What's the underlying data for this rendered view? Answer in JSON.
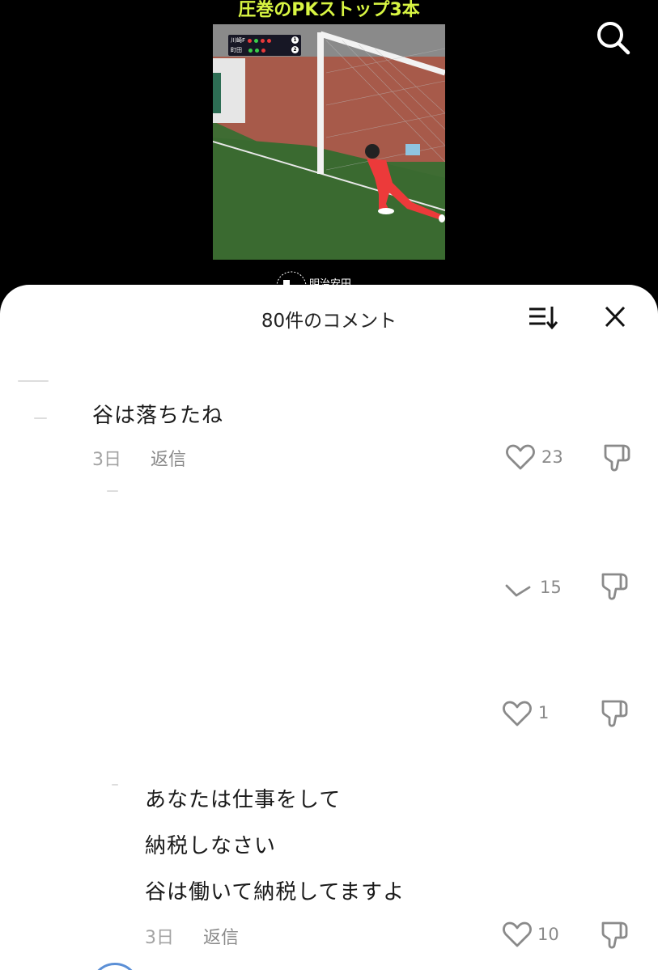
{
  "video": {
    "title": "圧巻のPKストップ3本",
    "scoreboard": {
      "team1": "川崎F",
      "team2": "町田",
      "score1": "1",
      "score2": "2"
    },
    "sponsor": "明治安田"
  },
  "comments_sheet": {
    "title": "80件のコメント",
    "comments": [
      {
        "lines": [
          "谷は落ちたね"
        ],
        "time": "3日",
        "reply_label": "返信",
        "likes": "23"
      },
      {
        "lines": [],
        "likes": "15"
      },
      {
        "lines": [],
        "likes": "1"
      },
      {
        "lines": [
          "あなたは仕事をして",
          "納税しなさい",
          "谷は働いて納税してますよ"
        ],
        "time": "3日",
        "reply_label": "返信",
        "likes": "10"
      }
    ]
  },
  "colors": {
    "title_accent": "#d8f542",
    "sheet_bg": "#ffffff",
    "meta_gray": "#a3a3a3"
  }
}
